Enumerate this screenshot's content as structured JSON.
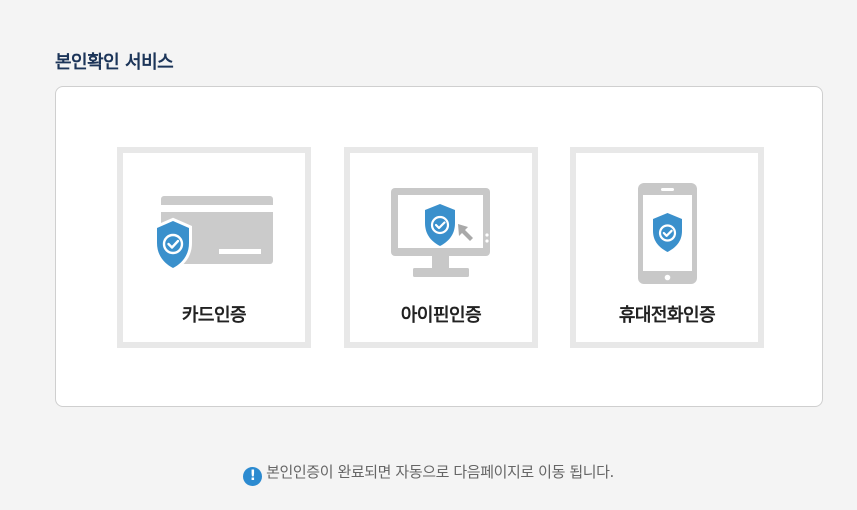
{
  "section": {
    "title": "본인확인 서비스"
  },
  "options": [
    {
      "id": "card",
      "label": "카드인증",
      "icon": "card-shield-icon"
    },
    {
      "id": "ipin",
      "label": "아이핀인증",
      "icon": "monitor-shield-icon"
    },
    {
      "id": "phone",
      "label": "휴대전화인증",
      "icon": "phone-shield-icon"
    }
  ],
  "notice": {
    "icon": "exclamation-icon",
    "text": "본인인증이 완료되면 자동으로 다음페이지로 이동 됩니다."
  },
  "colors": {
    "accent": "#2b8ad0",
    "shield": "#3a90cc",
    "device": "#c8c8c8",
    "title": "#1c3559"
  }
}
